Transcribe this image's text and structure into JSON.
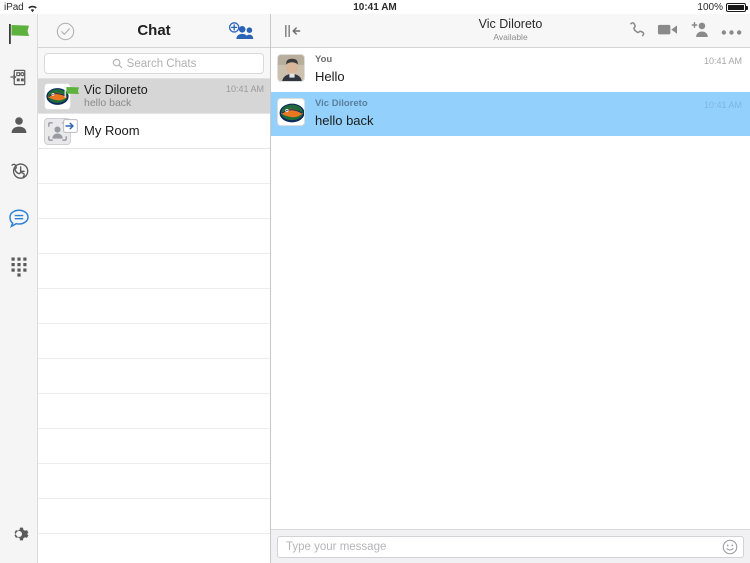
{
  "status_bar": {
    "device": "iPad",
    "wifi_icon": "wifi-icon",
    "time": "10:41 AM",
    "battery_percent": "100%",
    "battery_icon": "battery-full-icon"
  },
  "rail": {
    "items": [
      {
        "icon": "green-flag-icon",
        "name": "rail-item-status",
        "active": false
      },
      {
        "icon": "file-transfer-icon",
        "name": "rail-item-transfers",
        "active": false
      },
      {
        "icon": "person-icon",
        "name": "rail-item-contacts",
        "active": false
      },
      {
        "icon": "call-history-icon",
        "name": "rail-item-history",
        "active": false
      },
      {
        "icon": "chat-bubble-icon",
        "name": "rail-item-chat",
        "active": true
      },
      {
        "icon": "dialpad-icon",
        "name": "rail-item-keypad",
        "active": false
      }
    ],
    "settings": {
      "icon": "gear-icon",
      "name": "rail-item-settings"
    }
  },
  "chat_list": {
    "header": {
      "title": "Chat",
      "check_icon": "check-circle-icon",
      "add_icon": "add-people-icon"
    },
    "search": {
      "placeholder": "Search Chats",
      "value": "",
      "icon": "search-icon"
    },
    "rows": [
      {
        "name": "Vic Diloreto",
        "preview": "hello back",
        "time": "10:41 AM",
        "avatar": "gator-avatar",
        "presence": "available-flag-icon",
        "selected": true
      },
      {
        "name": "My Room",
        "preview": "",
        "time": "",
        "avatar": "room-avatar-icon",
        "presence": "enter-room-icon",
        "selected": false
      }
    ],
    "empty_row_count": 11
  },
  "conversation": {
    "header": {
      "collapse_icon": "collapse-panel-icon",
      "name": "Vic Diloreto",
      "status": "Available",
      "actions": [
        {
          "icon": "phone-icon",
          "name": "audio-call-button"
        },
        {
          "icon": "video-camera-icon",
          "name": "video-call-button"
        },
        {
          "icon": "add-person-icon",
          "name": "add-participant-button"
        },
        {
          "icon": "ellipsis-icon",
          "name": "more-options-button"
        }
      ]
    },
    "messages": [
      {
        "author": "You",
        "text": "Hello",
        "time": "10:41 AM",
        "avatar": "user-photo-avatar",
        "highlight": false
      },
      {
        "author": "Vic Diloreto",
        "text": "hello back",
        "time": "10:41 AM",
        "avatar": "gator-avatar",
        "highlight": true
      }
    ],
    "composer": {
      "placeholder": "Type your message",
      "value": "",
      "emoji_icon": "smiley-icon"
    }
  },
  "colors": {
    "highlight_blue": "#93d0fc",
    "accent_blue": "#2f80d8",
    "selected_gray": "#d6d6d6",
    "flag_green": "#5cb23c",
    "header_gray": "#f7f7f7"
  }
}
